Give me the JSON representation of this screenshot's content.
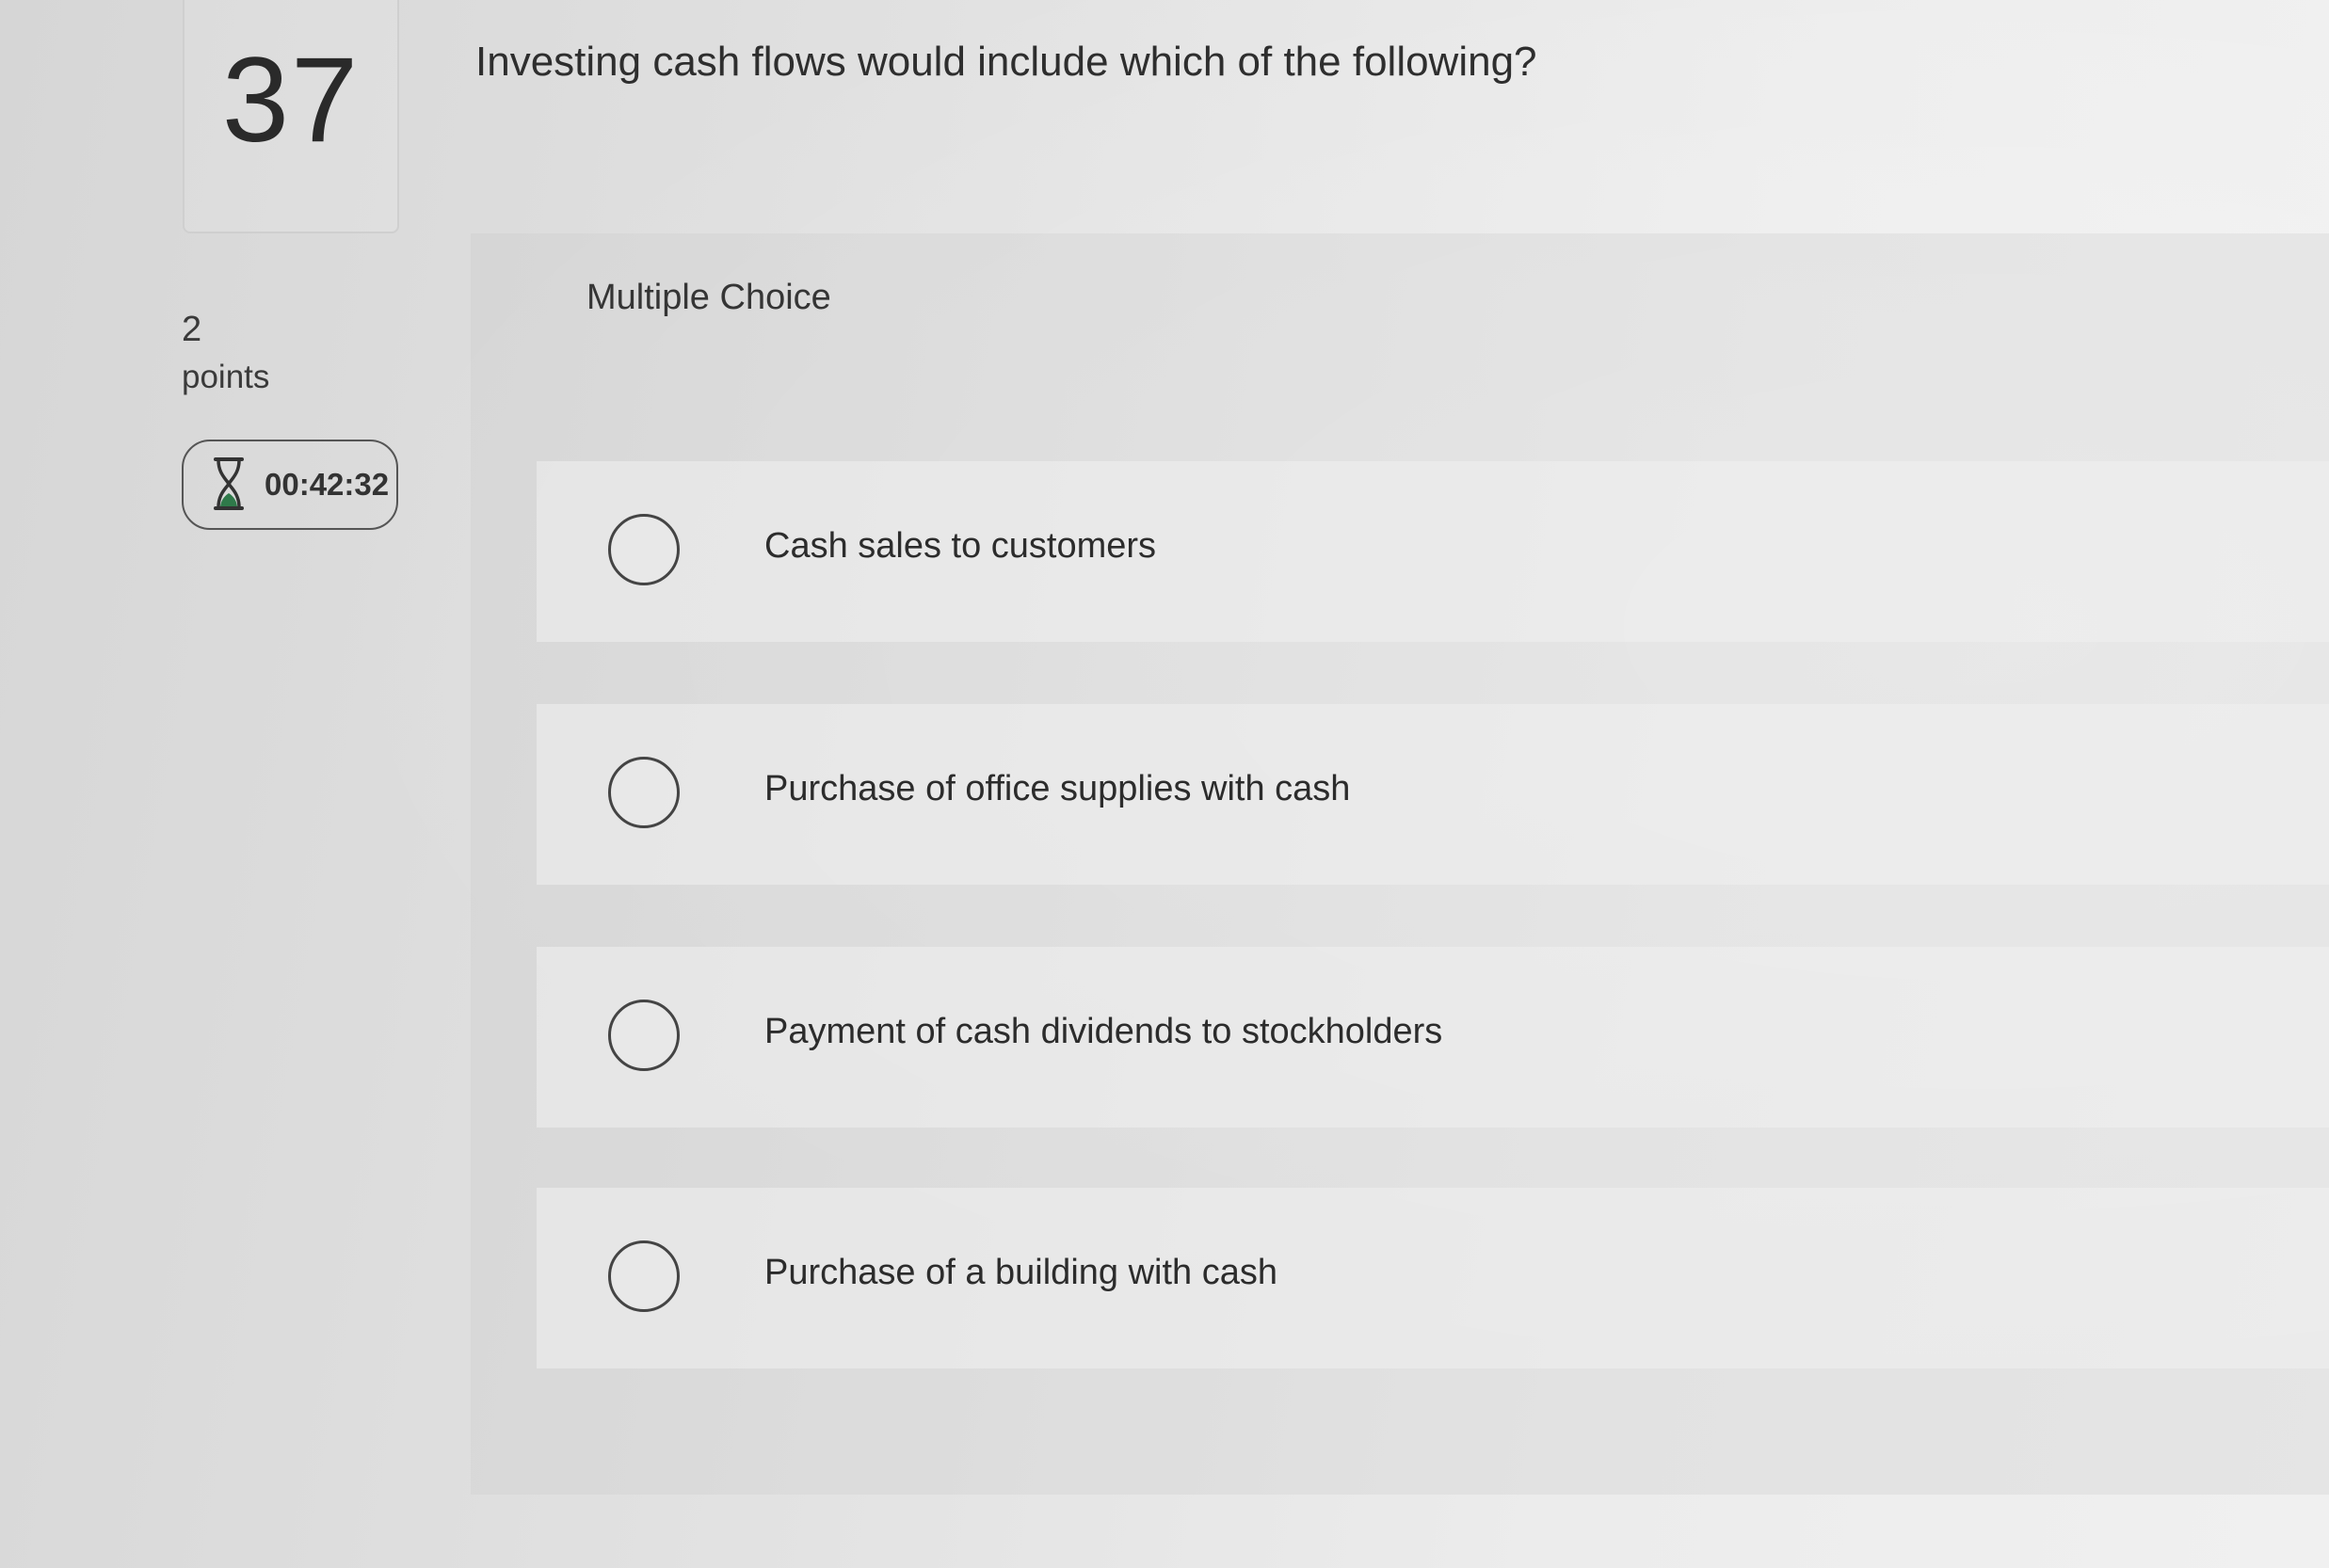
{
  "question": {
    "number": "37",
    "points_value": "2",
    "points_label": "points",
    "timer": "00:42:32",
    "timer_icon": "hourglass-icon",
    "text": "Investing cash flows would include which of the following?",
    "type_label": "Multiple Choice"
  },
  "options": [
    {
      "label": "Cash sales to customers",
      "selected": false
    },
    {
      "label": "Purchase of office supplies with cash",
      "selected": false
    },
    {
      "label": "Payment of cash dividends to stockholders",
      "selected": false
    },
    {
      "label": "Purchase of a building with cash",
      "selected": false
    }
  ]
}
